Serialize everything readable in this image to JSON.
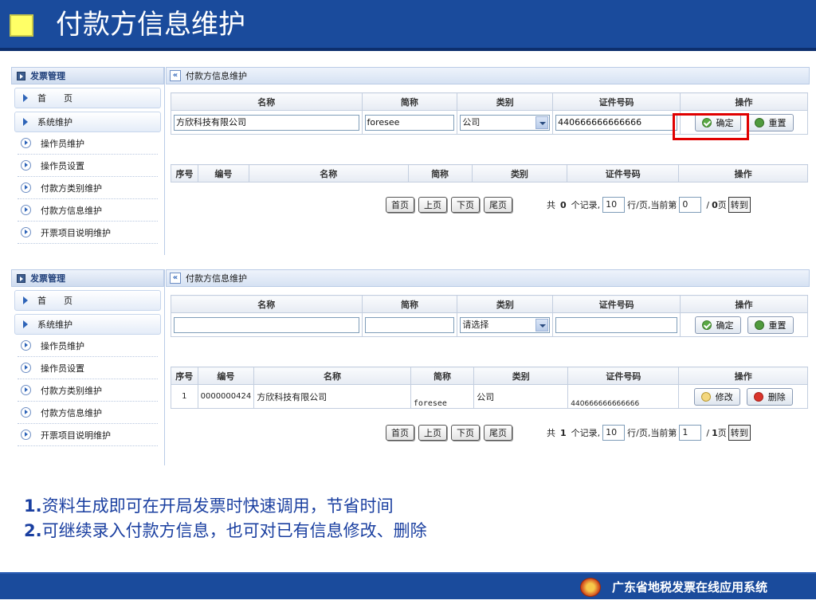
{
  "title": "付款方信息维护",
  "panels": [
    {
      "sidebar": {
        "header": "发票管理",
        "main_items": [
          "首　　页",
          "系统维护"
        ],
        "sub_items": [
          "操作员维护",
          "操作员设置",
          "付款方类别维护",
          "付款方信息维护",
          "开票项目说明维护"
        ]
      },
      "breadcrumb": "付款方信息维护",
      "form": {
        "headers": [
          "名称",
          "简称",
          "类别",
          "证件号码",
          "操作"
        ],
        "name_value": "方欣科技有限公司",
        "short_value": "foresee",
        "category_value": "公司",
        "id_value": "440666666666666",
        "confirm_label": "确定",
        "reset_label": "重置"
      },
      "list": {
        "headers": [
          "序号",
          "编号",
          "名称",
          "简称",
          "类别",
          "证件号码",
          "操作"
        ],
        "rows": []
      },
      "pager": {
        "first": "首页",
        "prev": "上页",
        "next": "下页",
        "last": "尾页",
        "total_prefix": "共",
        "total": "0",
        "total_suffix": "个记录,",
        "per_page": "10",
        "per_page_suffix": "行/页,当前第",
        "current": "0",
        "sep": "/",
        "pages": "0",
        "pages_suffix": "页",
        "go": "转到"
      }
    },
    {
      "sidebar": {
        "header": "发票管理",
        "main_items": [
          "首　　页",
          "系统维护"
        ],
        "sub_items": [
          "操作员维护",
          "操作员设置",
          "付款方类别维护",
          "付款方信息维护",
          "开票项目说明维护"
        ]
      },
      "breadcrumb": "付款方信息维护",
      "form": {
        "headers": [
          "名称",
          "简称",
          "类别",
          "证件号码",
          "操作"
        ],
        "name_value": "",
        "short_value": "",
        "category_value": "请选择",
        "id_value": "",
        "confirm_label": "确定",
        "reset_label": "重置"
      },
      "list": {
        "headers": [
          "序号",
          "编号",
          "名称",
          "简称",
          "类别",
          "证件号码",
          "操作"
        ],
        "rows": [
          {
            "seq": "1",
            "code": "0000000424",
            "name": "方欣科技有限公司",
            "short": "foresee",
            "category": "公司",
            "id": "440666666666666",
            "edit_label": "修改",
            "delete_label": "删除"
          }
        ]
      },
      "pager": {
        "first": "首页",
        "prev": "上页",
        "next": "下页",
        "last": "尾页",
        "total_prefix": "共",
        "total": "1",
        "total_suffix": "个记录,",
        "per_page": "10",
        "per_page_suffix": "行/页,当前第",
        "current": "1",
        "sep": "/",
        "pages": "1",
        "pages_suffix": "页",
        "go": "转到"
      }
    }
  ],
  "notes": [
    {
      "num": "1.",
      "text": "资料生成即可在开局发票时快速调用，节省时间"
    },
    {
      "num": "2.",
      "text": "可继续录入付款方信息，也可对已有信息修改、删除"
    }
  ],
  "footer": "广东省地税发票在线应用系统"
}
